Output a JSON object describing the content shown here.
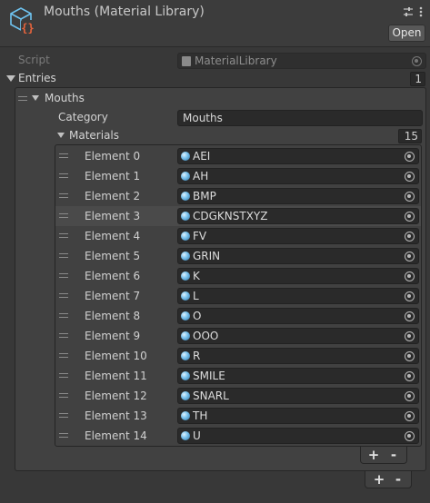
{
  "header": {
    "title": "Mouths (Material Library)",
    "open_label": "Open",
    "settings_icon": "sliders-icon",
    "menu_icon": "kebab-menu-icon"
  },
  "script": {
    "label": "Script",
    "value": "MaterialLibrary"
  },
  "entries": {
    "label": "Entries",
    "count": "1",
    "item": {
      "label": "Mouths",
      "category_label": "Category",
      "category_value": "Mouths",
      "materials_label": "Materials",
      "materials_count": "15",
      "elements": [
        {
          "label": "Element 0",
          "value": "AEI"
        },
        {
          "label": "Element 1",
          "value": "AH"
        },
        {
          "label": "Element 2",
          "value": "BMP"
        },
        {
          "label": "Element 3",
          "value": "CDGKNSTXYZ"
        },
        {
          "label": "Element 4",
          "value": "FV"
        },
        {
          "label": "Element 5",
          "value": "GRIN"
        },
        {
          "label": "Element 6",
          "value": "K"
        },
        {
          "label": "Element 7",
          "value": "L"
        },
        {
          "label": "Element 8",
          "value": "O"
        },
        {
          "label": "Element 9",
          "value": "OOO"
        },
        {
          "label": "Element 10",
          "value": "R"
        },
        {
          "label": "Element 11",
          "value": "SMILE"
        },
        {
          "label": "Element 12",
          "value": "SNARL"
        },
        {
          "label": "Element 13",
          "value": "TH"
        },
        {
          "label": "Element 14",
          "value": "U"
        }
      ]
    }
  },
  "list_buttons": {
    "add": "+",
    "remove": "-"
  },
  "colors": {
    "background": "#383838",
    "field": "#2a2a2a",
    "highlight_row": "#4a4a4a",
    "icon_orange": "#e8643c",
    "icon_blue": "#6ec3f0"
  }
}
